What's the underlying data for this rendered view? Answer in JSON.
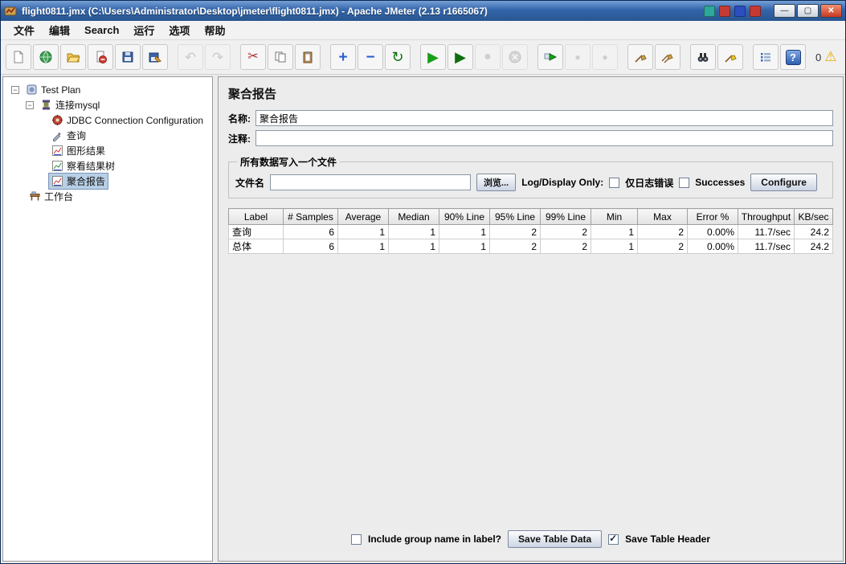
{
  "window": {
    "title": "flight0811.jmx (C:\\Users\\Administrator\\Desktop\\jmeter\\flight0811.jmx) - Apache JMeter (2.13 r1665067)"
  },
  "menu": {
    "items": [
      "文件",
      "编辑",
      "Search",
      "运行",
      "选项",
      "帮助"
    ]
  },
  "toolbar": {
    "icons": [
      "new-file",
      "templates",
      "open-file",
      "close-file",
      "save",
      "save-as",
      "undo",
      "redo",
      "cut",
      "copy",
      "paste",
      "expand-all",
      "collapse-all",
      "toggle",
      "start",
      "start-no-pauses",
      "stop",
      "shutdown",
      "remote-start-all",
      "remote-stop-all",
      "remote-shutdown-all",
      "clear",
      "clear-all",
      "search",
      "search-reset",
      "function-helper",
      "help",
      "warning"
    ],
    "warning_count": "0"
  },
  "tree": {
    "items": [
      {
        "label": "Test Plan",
        "icon": "test-plan-icon",
        "selected": false
      },
      {
        "label": "连接mysql",
        "icon": "thread-group-icon",
        "selected": false
      },
      {
        "label": "JDBC Connection Configuration",
        "icon": "jdbc-config-icon",
        "selected": false
      },
      {
        "label": "查询",
        "icon": "jdbc-sampler-icon",
        "selected": false
      },
      {
        "label": "图形结果",
        "icon": "graph-results-icon",
        "selected": false
      },
      {
        "label": "察看结果树",
        "icon": "view-results-tree-icon",
        "selected": false
      },
      {
        "label": "聚合报告",
        "icon": "aggregate-report-icon",
        "selected": true
      },
      {
        "label": "工作台",
        "icon": "workbench-icon",
        "selected": false
      }
    ]
  },
  "main": {
    "title": "聚合报告",
    "name_label": "名称:",
    "name_value": "聚合报告",
    "comment_label": "注释:",
    "comment_value": "",
    "file_section": {
      "title": "所有数据写入一个文件",
      "filename_label": "文件名",
      "filename_value": "",
      "browse_button": "浏览...",
      "log_display_label": "Log/Display Only:",
      "errors_checkbox_label": "仅日志错误",
      "errors_checked": false,
      "successes_checkbox_label": "Successes",
      "successes_checked": false,
      "configure_button": "Configure"
    },
    "table": {
      "headers": [
        "Label",
        "# Samples",
        "Average",
        "Median",
        "90% Line",
        "95% Line",
        "99% Line",
        "Min",
        "Max",
        "Error %",
        "Throughput",
        "KB/sec"
      ],
      "rows": [
        [
          "查询",
          "6",
          "1",
          "1",
          "1",
          "2",
          "2",
          "1",
          "2",
          "0.00%",
          "11.7/sec",
          "24.2"
        ],
        [
          "总体",
          "6",
          "1",
          "1",
          "1",
          "2",
          "2",
          "1",
          "2",
          "0.00%",
          "11.7/sec",
          "24.2"
        ]
      ]
    },
    "footer": {
      "include_group_label": "Include group name in label?",
      "include_group_checked": false,
      "save_table_button": "Save Table Data",
      "save_header_label": "Save Table Header",
      "save_header_checked": true
    }
  }
}
